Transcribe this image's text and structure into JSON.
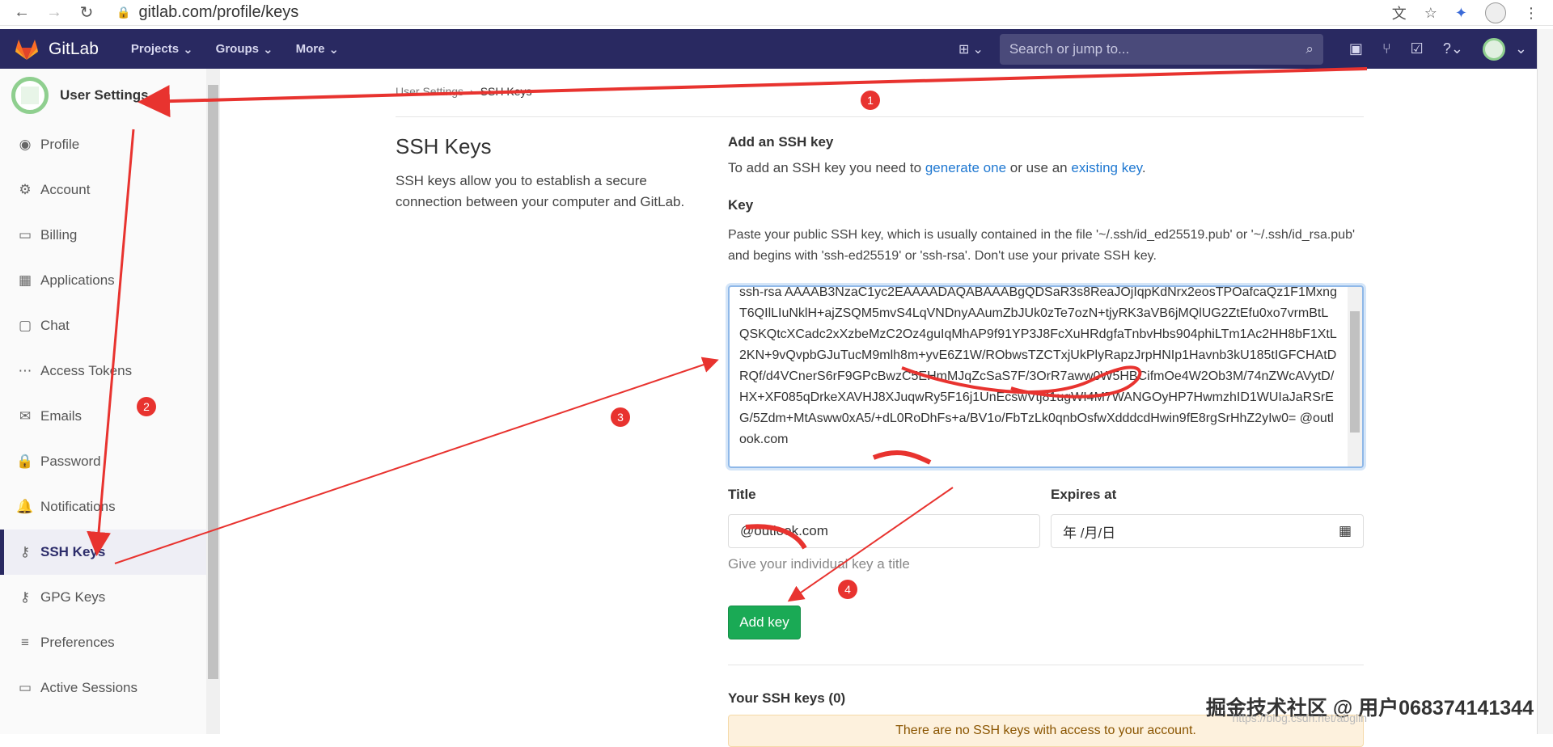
{
  "browser": {
    "url": "gitlab.com/profile/keys"
  },
  "navbar": {
    "brand": "GitLab",
    "links": [
      "Projects",
      "Groups",
      "More"
    ],
    "search_placeholder": "Search or jump to..."
  },
  "sidebar": {
    "title": "User Settings",
    "items": [
      {
        "label": "Profile",
        "icon": "profile-icon"
      },
      {
        "label": "Account",
        "icon": "account-icon"
      },
      {
        "label": "Billing",
        "icon": "billing-icon"
      },
      {
        "label": "Applications",
        "icon": "applications-icon"
      },
      {
        "label": "Chat",
        "icon": "chat-icon"
      },
      {
        "label": "Access Tokens",
        "icon": "access-tokens-icon"
      },
      {
        "label": "Emails",
        "icon": "email-icon"
      },
      {
        "label": "Password",
        "icon": "lock-icon"
      },
      {
        "label": "Notifications",
        "icon": "bell-icon"
      },
      {
        "label": "SSH Keys",
        "icon": "key-icon"
      },
      {
        "label": "GPG Keys",
        "icon": "key-icon"
      },
      {
        "label": "Preferences",
        "icon": "sliders-icon"
      },
      {
        "label": "Active Sessions",
        "icon": "monitor-icon"
      }
    ]
  },
  "breadcrumb": {
    "parent": "User Settings",
    "current": "SSH Keys"
  },
  "section": {
    "title": "SSH Keys",
    "description": "SSH keys allow you to establish a secure connection between your computer and GitLab."
  },
  "form": {
    "heading": "Add an SSH key",
    "intro_prefix": "To add an SSH key you need to ",
    "generate_link": "generate one",
    "intro_mid": " or use an ",
    "existing_link": "existing key",
    "intro_suffix": ".",
    "key_label": "Key",
    "key_help": "Paste your public SSH key, which is usually contained in the file '~/.ssh/id_ed25519.pub' or '~/.ssh/id_rsa.pub' and begins with 'ssh-ed25519' or 'ssh-rsa'. Don't use your private SSH key.",
    "key_value": "ssh-rsa AAAAB3NzaC1yc2EAAAADAQABAAABgQDSaR3s8ReaJOjIqpKdNrx2eosTPOafcaQz1F1MxngT6QIlLIuNklH+ajZSQM5mvS4LqVNDnyAAumZbJUk0zTe7ozN+tjyRK3aVB6jMQlUG2ZtEfu0xo7vrmBtLQSKQtcXCadc2xXzbeMzC2Oz4guIqMhAP9f91YP3J8FcXuHRdgfaTnbvHbs904phiLTm1Ac2HH8bF1XtL2KN+9vQvpbGJuTucM9mlh8m+yvE6Z1W/RObwsTZCTxjUkPlyRapzJrpHNIp1Havnb3kU185tIGFCHAtDRQf/d4VCnerS6rF9GPcBwzC5EHmMJqZcSaS7F/3OrR7aww0W5HBCifmOe4W2Ob3M/74nZWcAVytD/HX+XF085qDrkeXAVHJ8XJuqwRy5F16j1UnEcswVtj81ugWI4M7WANGOyHP7HwmzhID1WUIaJaRSrEG/5Zdm+MtAsww0xA5/+dL0RoDhFs+a/BV1o/FbTzLk0qnbOsfwXdddcdHwin9fE8rgSrHhZ2yIw0= @outlook.com",
    "title_label": "Title",
    "title_value": "@outlook.com",
    "expires_label": "Expires at",
    "expires_value": "年 /月/日",
    "title_hint": "Give your individual key a title",
    "submit": "Add key"
  },
  "your_keys": {
    "heading": "Your SSH keys (0)",
    "empty_message": "There are no SSH keys with access to your account."
  },
  "annotations": [
    "1",
    "2",
    "3",
    "4"
  ],
  "watermark": "掘金技术社区 @ 用户06837414134​4",
  "watermark_url": "https://blog.csdn.net/abglin",
  "colors": {
    "navbar": "#292961",
    "accent_green": "#1aaa55",
    "link": "#1f78d1",
    "annotation_red": "#e8332f"
  }
}
